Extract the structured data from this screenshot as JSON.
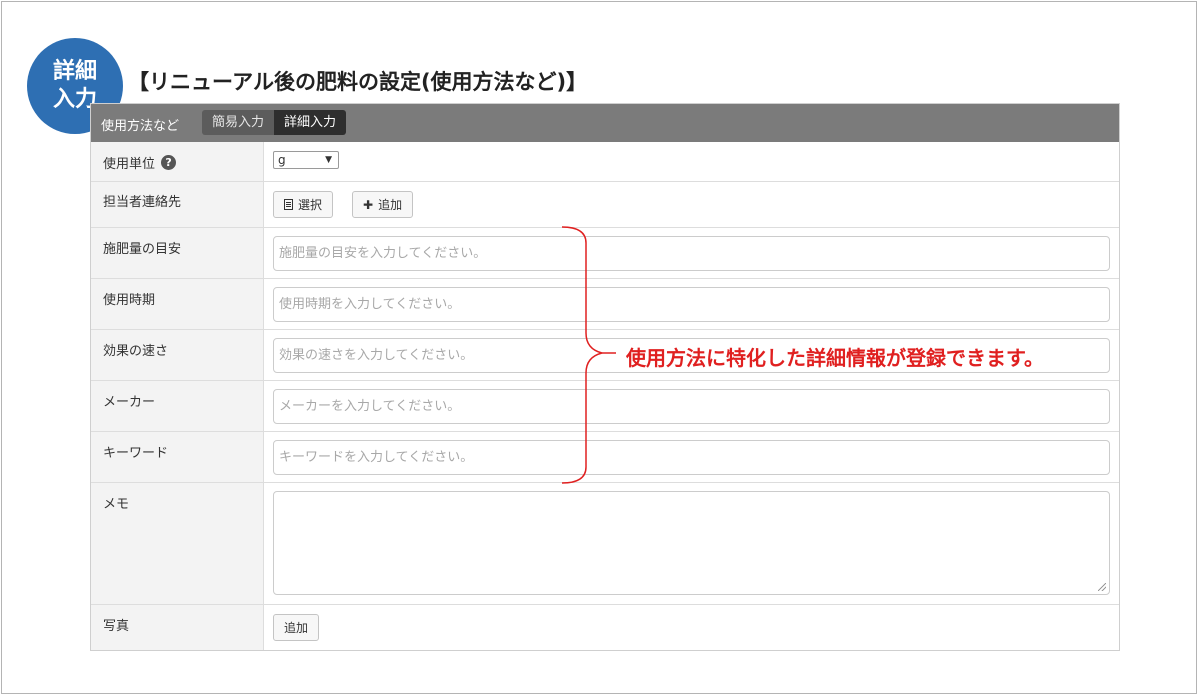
{
  "badge": {
    "line1": "詳細",
    "line2": "入力"
  },
  "heading": "【リニューアル後の肥料の設定(使用方法など)】",
  "panel": {
    "title": "使用方法など",
    "tabs": [
      {
        "label": "簡易入力",
        "active": false
      },
      {
        "label": "詳細入力",
        "active": true
      }
    ]
  },
  "rows": {
    "unit": {
      "label": "使用単位",
      "help_icon": "?",
      "select_value": "g"
    },
    "contact": {
      "label": "担当者連絡先",
      "select_button": "選択",
      "add_button": "追加"
    },
    "fertilizer_amount": {
      "label": "施肥量の目安",
      "placeholder": "施肥量の目安を入力してください。"
    },
    "usage_time": {
      "label": "使用時期",
      "placeholder": "使用時期を入力してください。"
    },
    "effect_speed": {
      "label": "効果の速さ",
      "placeholder": "効果の速さを入力してください。"
    },
    "maker": {
      "label": "メーカー",
      "placeholder": "メーカーを入力してください。"
    },
    "keyword": {
      "label": "キーワード",
      "placeholder": "キーワードを入力してください。"
    },
    "memo": {
      "label": "メモ"
    },
    "photo": {
      "label": "写真",
      "add_button": "追加"
    }
  },
  "callout": "使用方法に特化した詳細情報が登録できます。",
  "colors": {
    "accent_blue": "#2e6fb3",
    "callout_red": "#e02020",
    "header_gray": "#7b7b7b"
  }
}
